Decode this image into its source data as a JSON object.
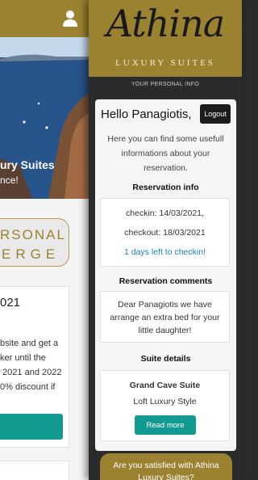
{
  "background_page": {
    "hero_title": "ury Suites",
    "hero_subtitle": "nce!",
    "concierge_line1": "RSONAL",
    "concierge_line2": "ERGE",
    "offer_year": "021",
    "offer_lines": "bsite and get a\nker until the\n 2021 and 2022\n0% discount if",
    "brand_color": "#9a8231",
    "button_color": "#139a90"
  },
  "panel": {
    "logo_script": "Athina",
    "logo_subtitle": "LUXURY SUITES",
    "caption": "YOUR PERSONAL INFO",
    "greeting": "Hello Panagiotis,",
    "logout_label": "Logout",
    "intro": "Here you can find some usefull informations about your reservation.",
    "reservation": {
      "title": "Reservation info",
      "checkin": "checkin: 14/03/2021,",
      "checkout": "checkout: 18/03/2021",
      "countdown": "1 days left to checkin!"
    },
    "comments": {
      "title": "Reservation comments",
      "text": "Dear Panagiotis we have arrange an extra bed for your little daughter!"
    },
    "suite": {
      "title": "Suite details",
      "name": "Grand Cave Suite",
      "style": "Loft Luxury Style",
      "read_more_label": "Read more"
    },
    "satisfied_prompt": "Are you satisfied with Athina\nLuxury Suites?"
  }
}
